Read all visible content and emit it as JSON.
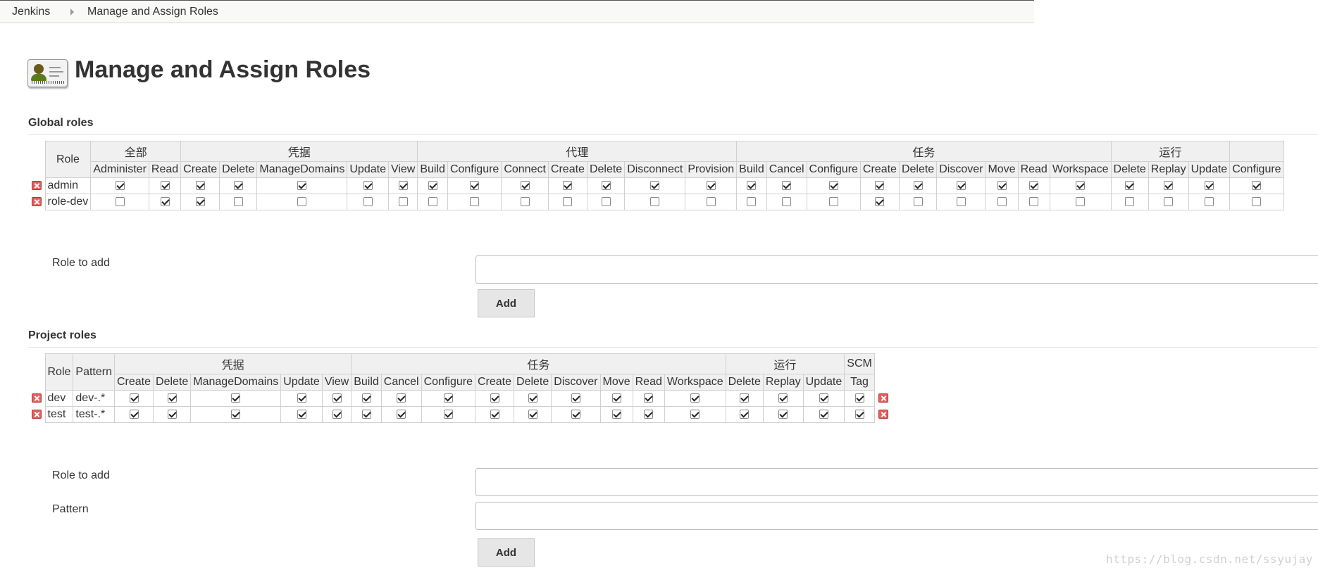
{
  "breadcrumb": [
    "Jenkins",
    "Manage and Assign Roles"
  ],
  "page_title": "Manage and Assign Roles",
  "global_roles": {
    "title": "Global roles",
    "role_header": "Role",
    "categories": [
      {
        "name": "全部",
        "perms": [
          "Administer",
          "Read"
        ]
      },
      {
        "name": "凭据",
        "perms": [
          "Create",
          "Delete",
          "ManageDomains",
          "Update",
          "View"
        ]
      },
      {
        "name": "代理",
        "perms": [
          "Build",
          "Configure",
          "Connect",
          "Create",
          "Delete",
          "Disconnect",
          "Provision"
        ]
      },
      {
        "name": "任务",
        "perms": [
          "Build",
          "Cancel",
          "Configure",
          "Create",
          "Delete",
          "Discover",
          "Move",
          "Read",
          "Workspace"
        ]
      },
      {
        "name": "运行",
        "perms": [
          "Delete",
          "Replay",
          "Update"
        ]
      },
      {
        "name": "",
        "perms": [
          "Configure"
        ]
      }
    ],
    "rows": [
      {
        "name": "admin",
        "checks": [
          true,
          true,
          true,
          true,
          true,
          true,
          true,
          true,
          true,
          true,
          true,
          true,
          true,
          true,
          true,
          true,
          true,
          true,
          true,
          true,
          true,
          true,
          true,
          true,
          true,
          true,
          true
        ]
      },
      {
        "name": "role-dev",
        "checks": [
          false,
          true,
          true,
          false,
          false,
          false,
          false,
          false,
          false,
          false,
          false,
          false,
          false,
          false,
          false,
          false,
          false,
          true,
          false,
          false,
          false,
          false,
          false,
          false,
          false,
          false,
          false
        ]
      }
    ],
    "role_to_add_label": "Role to add",
    "role_to_add_value": "",
    "add_label": "Add"
  },
  "project_roles": {
    "title": "Project roles",
    "role_header": "Role",
    "pattern_header": "Pattern",
    "categories": [
      {
        "name": "凭据",
        "perms": [
          "Create",
          "Delete",
          "ManageDomains",
          "Update",
          "View"
        ]
      },
      {
        "name": "任务",
        "perms": [
          "Build",
          "Cancel",
          "Configure",
          "Create",
          "Delete",
          "Discover",
          "Move",
          "Read",
          "Workspace"
        ]
      },
      {
        "name": "运行",
        "perms": [
          "Delete",
          "Replay",
          "Update"
        ]
      },
      {
        "name": "SCM",
        "perms": [
          "Tag"
        ]
      }
    ],
    "rows": [
      {
        "name": "dev",
        "pattern": "dev-.*",
        "checks": [
          true,
          true,
          true,
          true,
          true,
          true,
          true,
          true,
          true,
          true,
          true,
          true,
          true,
          true,
          true,
          true,
          true,
          true
        ]
      },
      {
        "name": "test",
        "pattern": "test-.*",
        "checks": [
          true,
          true,
          true,
          true,
          true,
          true,
          true,
          true,
          true,
          true,
          true,
          true,
          true,
          true,
          true,
          true,
          true,
          true
        ]
      }
    ],
    "role_to_add_label": "Role to add",
    "pattern_label": "Pattern",
    "role_to_add_value": "",
    "pattern_value": "",
    "add_label": "Add"
  },
  "watermark": "https://blog.csdn.net/ssyujay",
  "colors": {
    "header_bg": "#f0f0f0",
    "delete_icon": "#e06060",
    "button_bg": "#e6e6e6"
  }
}
